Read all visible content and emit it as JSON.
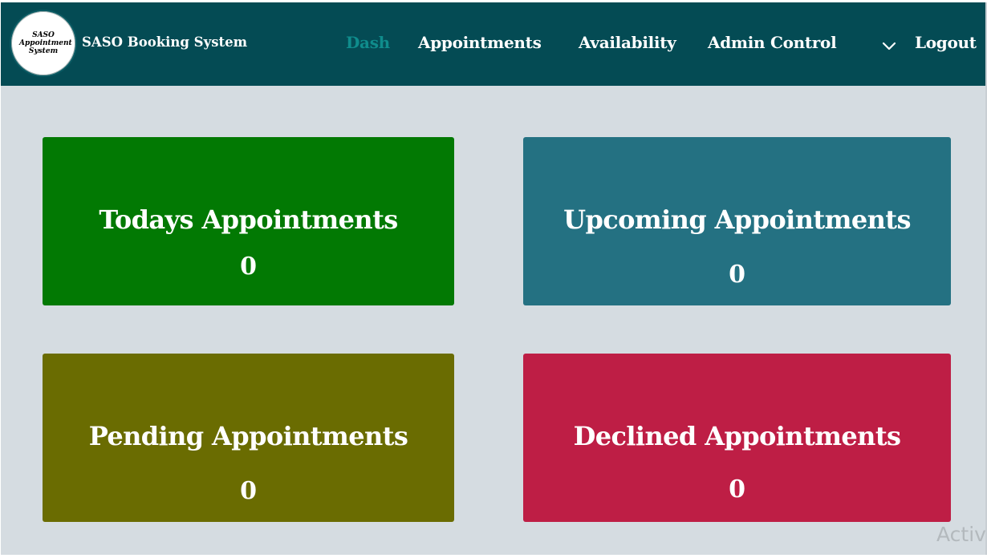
{
  "header": {
    "logo_text": "SASO\nAppointment\nSystem",
    "brand": "SASO Booking System",
    "nav": [
      {
        "label": "Dash",
        "active": true
      },
      {
        "label": "Appointments",
        "active": false
      },
      {
        "label": "Availability",
        "active": false
      },
      {
        "label": "Admin Control",
        "active": false
      }
    ],
    "logout_label": "Logout"
  },
  "cards": [
    {
      "title": "Todays Appointments",
      "count": "0",
      "color": "#027903"
    },
    {
      "title": "Upcoming Appointments",
      "count": "0",
      "color": "#247182"
    },
    {
      "title": "Pending Appointments",
      "count": "0",
      "color": "#6a6c01"
    },
    {
      "title": "Declined Appointments",
      "count": "0",
      "color": "#be1e45"
    }
  ],
  "watermark": "Activ",
  "colors": {
    "navbar": "#044b54",
    "nav_active": "#0f8c8c",
    "background": "#d5dce1"
  }
}
